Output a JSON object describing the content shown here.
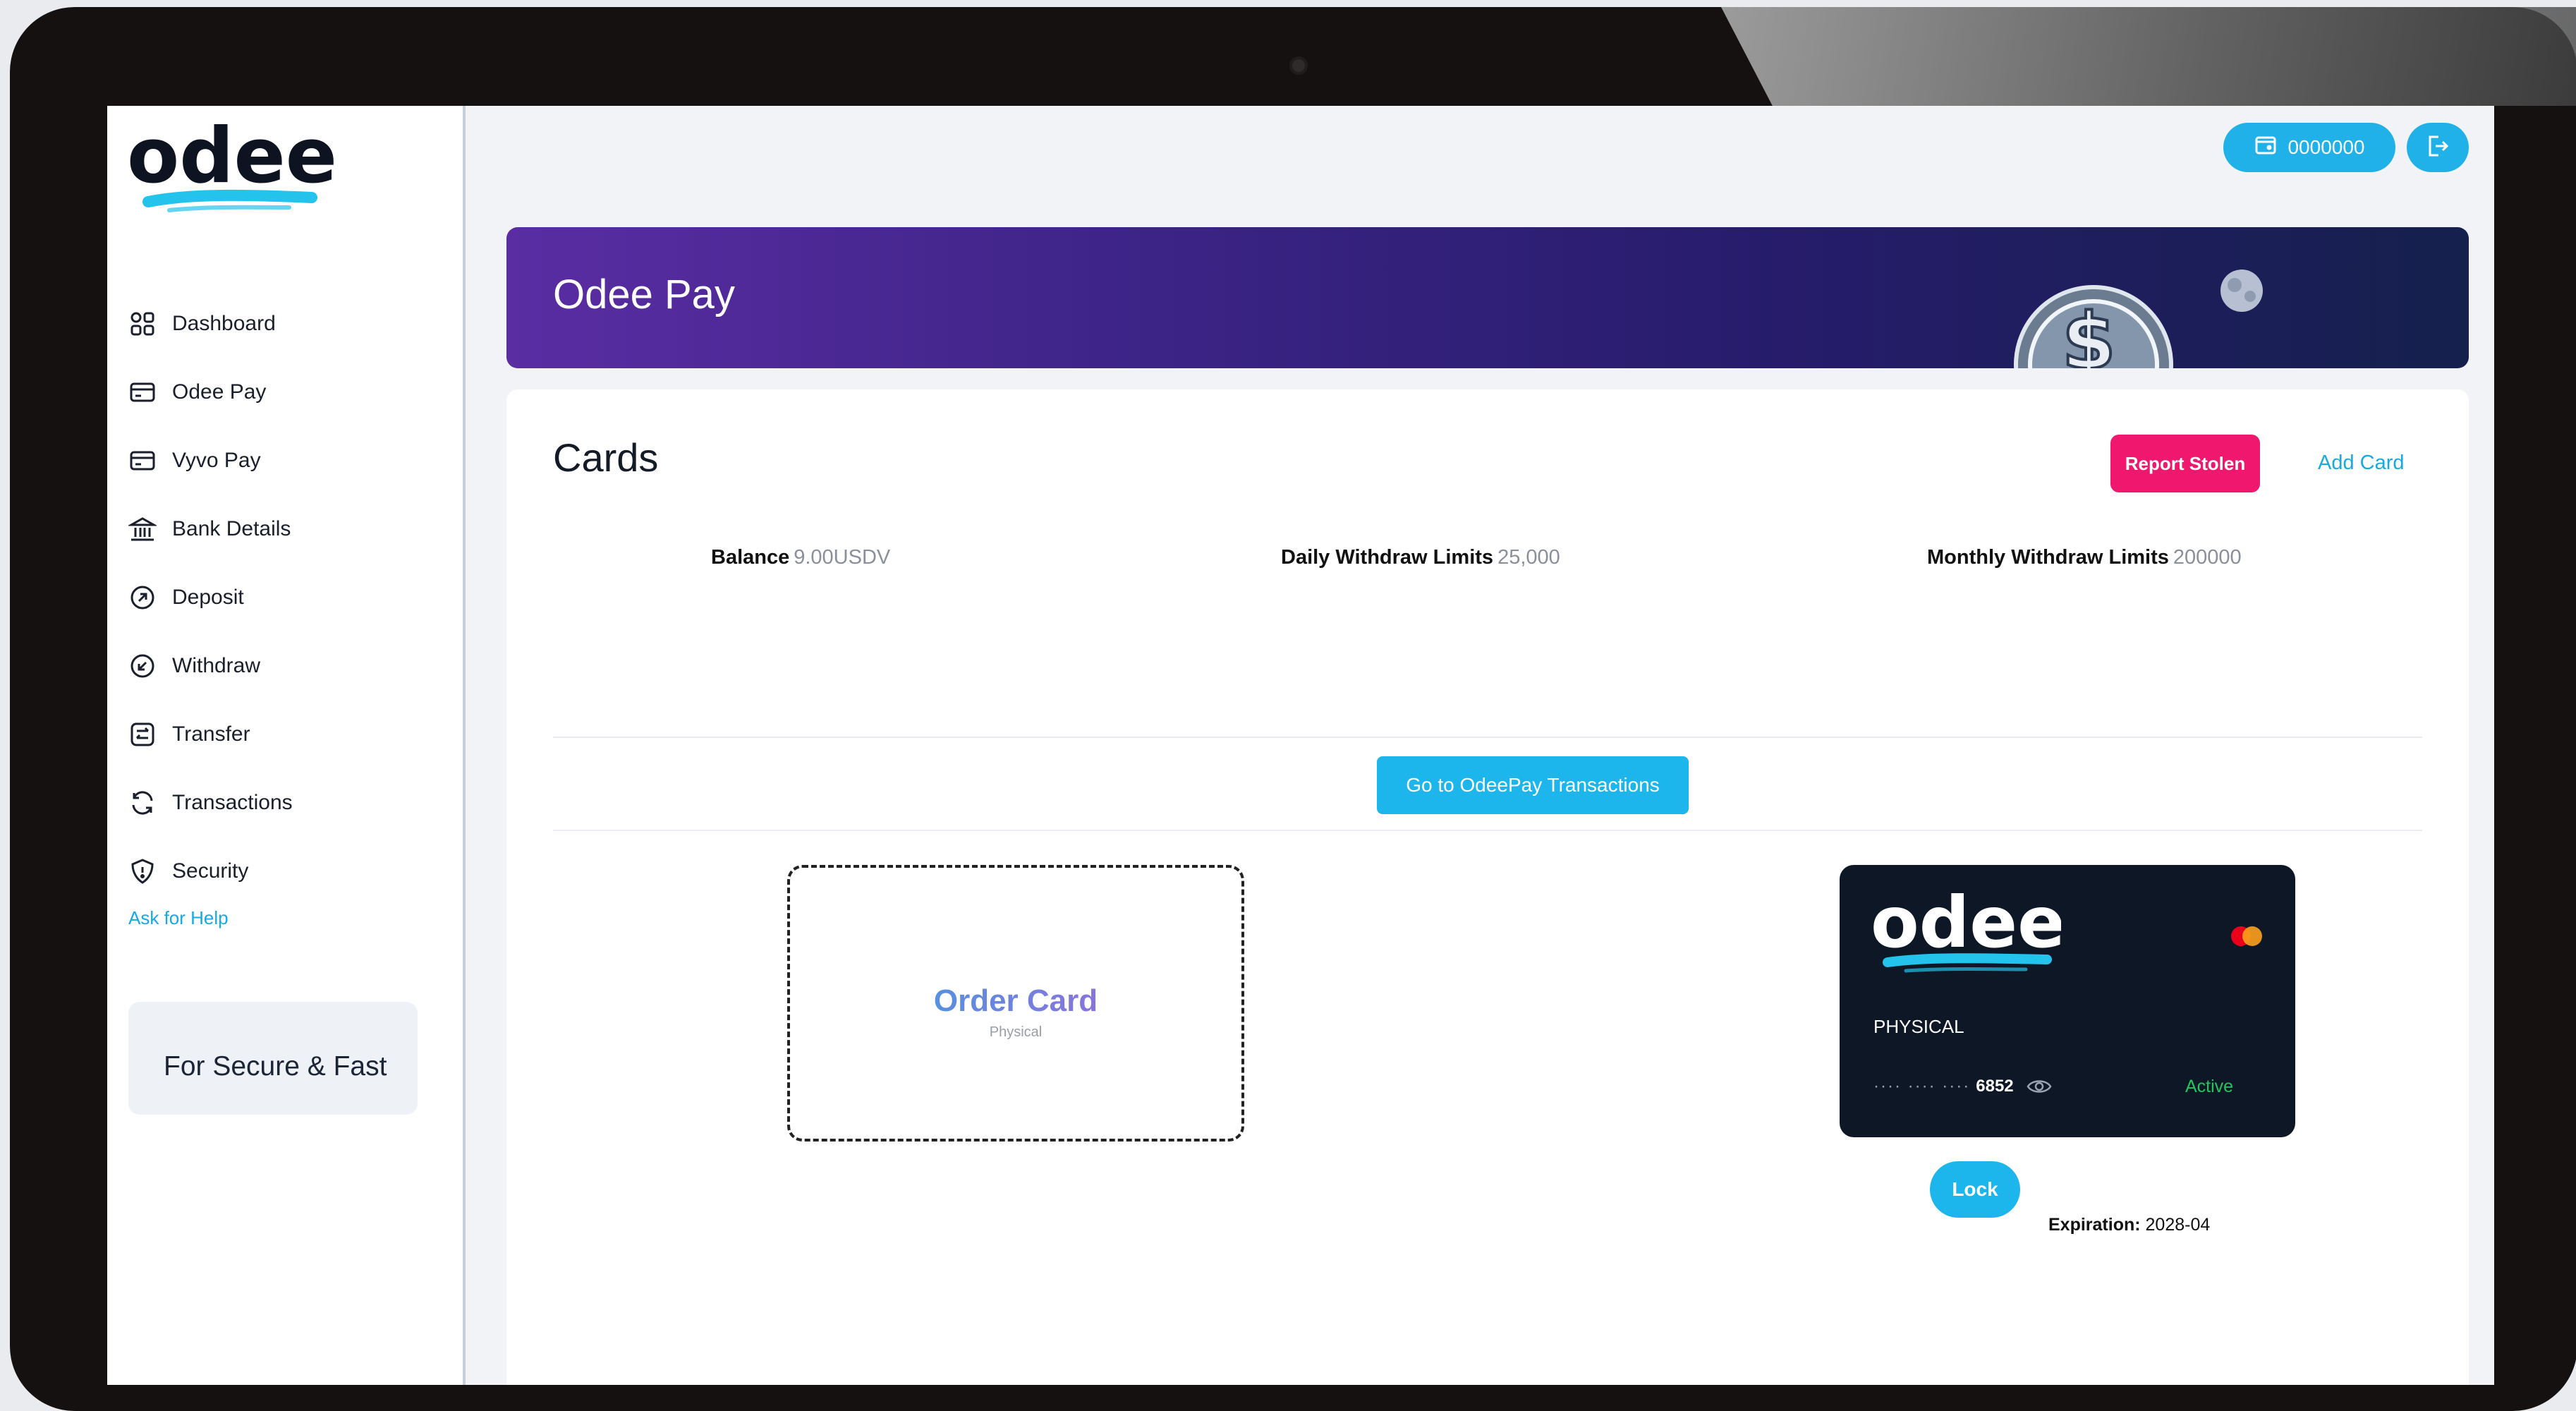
{
  "sidebar": {
    "logo_text": "odee",
    "items": [
      {
        "label": "Dashboard",
        "icon": "grid-icon"
      },
      {
        "label": "Odee Pay",
        "icon": "card-icon"
      },
      {
        "label": "Vyvo Pay",
        "icon": "card-icon"
      },
      {
        "label": "Bank Details",
        "icon": "bank-icon"
      },
      {
        "label": "Deposit",
        "icon": "deposit-icon"
      },
      {
        "label": "Withdraw",
        "icon": "withdraw-icon"
      },
      {
        "label": "Transfer",
        "icon": "transfer-icon"
      },
      {
        "label": "Transactions",
        "icon": "refresh-icon"
      },
      {
        "label": "Security",
        "icon": "shield-icon"
      }
    ],
    "help_link": "Ask for Help",
    "promo_text": "For Secure & Fast"
  },
  "topbar": {
    "wallet_value": "0000000",
    "wallet_icon": "wallet-icon",
    "logout_icon": "logout-icon"
  },
  "banner": {
    "title": "Odee Pay"
  },
  "cards": {
    "title": "Cards",
    "report_stolen_label": "Report Stolen",
    "add_card_label": "Add Card",
    "stats": {
      "balance_label": "Balance",
      "balance_value": "9.00USDV",
      "daily_label": "Daily Withdraw Limits",
      "daily_value": "25,000",
      "monthly_label": "Monthly Withdraw Limits",
      "monthly_value": "200000"
    },
    "transactions_button": "Go to OdeePay Transactions",
    "order_card": {
      "title": "Order Card",
      "subtitle": "Physical"
    },
    "card": {
      "brand": "odee",
      "type": "PHYSICAL",
      "masked_prefix": "···· ···· ····",
      "last4": "6852",
      "status": "Active",
      "status_color": "#22c55e"
    },
    "lock_label": "Lock",
    "expiration_label": "Expiration:",
    "expiration_value": "2028-04"
  },
  "colors": {
    "accent": "#1fb1e7",
    "danger": "#f0186e",
    "banner_start": "#5a2da3",
    "banner_end": "#15204d"
  }
}
